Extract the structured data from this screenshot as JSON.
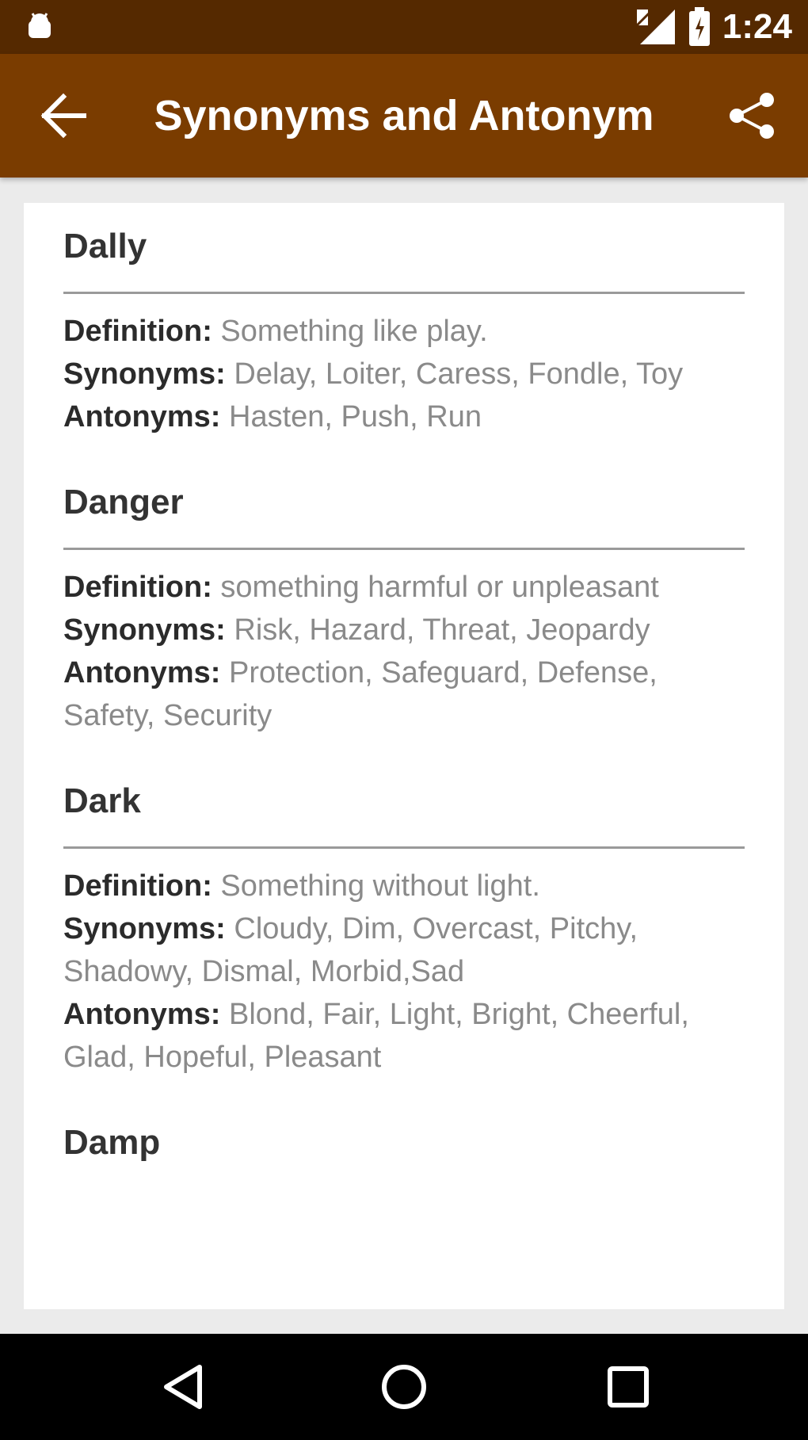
{
  "status_bar": {
    "time": "1:24",
    "icons": [
      "android-icon",
      "signal-icon",
      "battery-icon"
    ]
  },
  "app_bar": {
    "title": "Synonyms and Antonym",
    "back_icon": "arrow-left-icon",
    "share_icon": "share-icon"
  },
  "labels": {
    "definition": "Definition:",
    "synonyms": "Synonyms:",
    "antonyms": "Antonyms:"
  },
  "entries": [
    {
      "word": "Dally",
      "definition": "Something like play.",
      "synonyms": "Delay, Loiter, Caress, Fondle, Toy",
      "antonyms": "Hasten, Push, Run"
    },
    {
      "word": "Danger",
      "definition": "something harmful or unpleasant",
      "synonyms": "Risk, Hazard, Threat, Jeopardy",
      "antonyms": "Protection, Safeguard, Defense, Safety, Security"
    },
    {
      "word": "Dark",
      "definition": "Something without light.",
      "synonyms": "Cloudy, Dim, Overcast, Pitchy, Shadowy, Dismal, Morbid,Sad",
      "antonyms": "Blond, Fair, Light, Bright, Cheerful, Glad, Hopeful, Pleasant"
    },
    {
      "word": "Damp"
    }
  ],
  "nav_bar": {
    "icons": [
      "back-triangle-icon",
      "home-circle-icon",
      "recents-square-icon"
    ]
  },
  "colors": {
    "status_bar": "#552900",
    "app_bar": "#7a3c00",
    "background": "#ebebeb"
  }
}
